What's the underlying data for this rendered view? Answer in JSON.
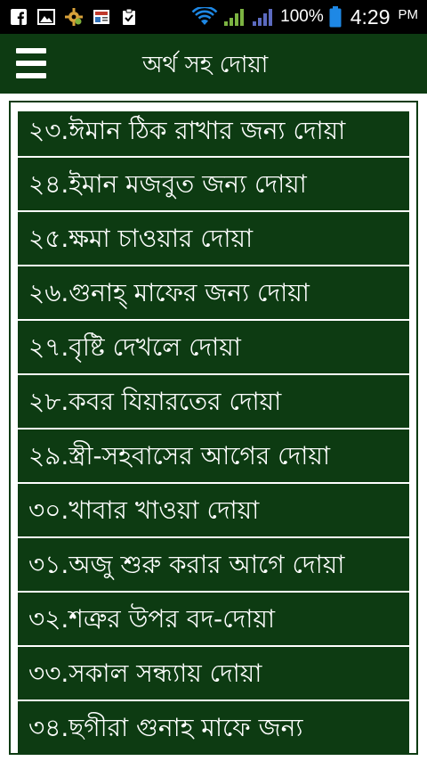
{
  "status_bar": {
    "icons": [
      "facebook-icon",
      "gallery-icon",
      "settings-gear-icon",
      "news-icon",
      "clipboard-check-icon",
      "wifi-icon",
      "signal-icon",
      "signal-icon-2",
      "battery-icon"
    ],
    "battery": "100%",
    "time": "4:29",
    "ampm": "PM"
  },
  "app_bar": {
    "title": "অর্থ সহ দোয়া"
  },
  "list": {
    "items": [
      {
        "label": "২৩.ঈমান ঠিক রাখার জন্য দোয়া"
      },
      {
        "label": "২৪.ইমান মজবুত জন্য দোয়া"
      },
      {
        "label": "২৫.ক্ষমা চাওয়ার দোয়া"
      },
      {
        "label": "২৬.গুনাহ্ মাফের জন্য দোয়া"
      },
      {
        "label": "২৭.বৃষ্টি দেখলে দোয়া"
      },
      {
        "label": "২৮.কবর যিয়ারতের দোয়া"
      },
      {
        "label": "২৯.স্ত্রী-সহবাসের আগের দোয়া"
      },
      {
        "label": "৩০.খাবার খাওয়া দোয়া"
      },
      {
        "label": "৩১.অজু শুরু করার আগে দোয়া"
      },
      {
        "label": "৩২.শত্রুর উপর বদ-দোয়া"
      },
      {
        "label": "৩৩.সকাল সন্ধ্যায় দোয়া"
      },
      {
        "label": "৩৪.ছগীরা গুনাহ মাফে জন্য"
      }
    ]
  },
  "colors": {
    "primary": "#0d3b12",
    "status_bar": "#000000",
    "text": "#ffffff"
  }
}
